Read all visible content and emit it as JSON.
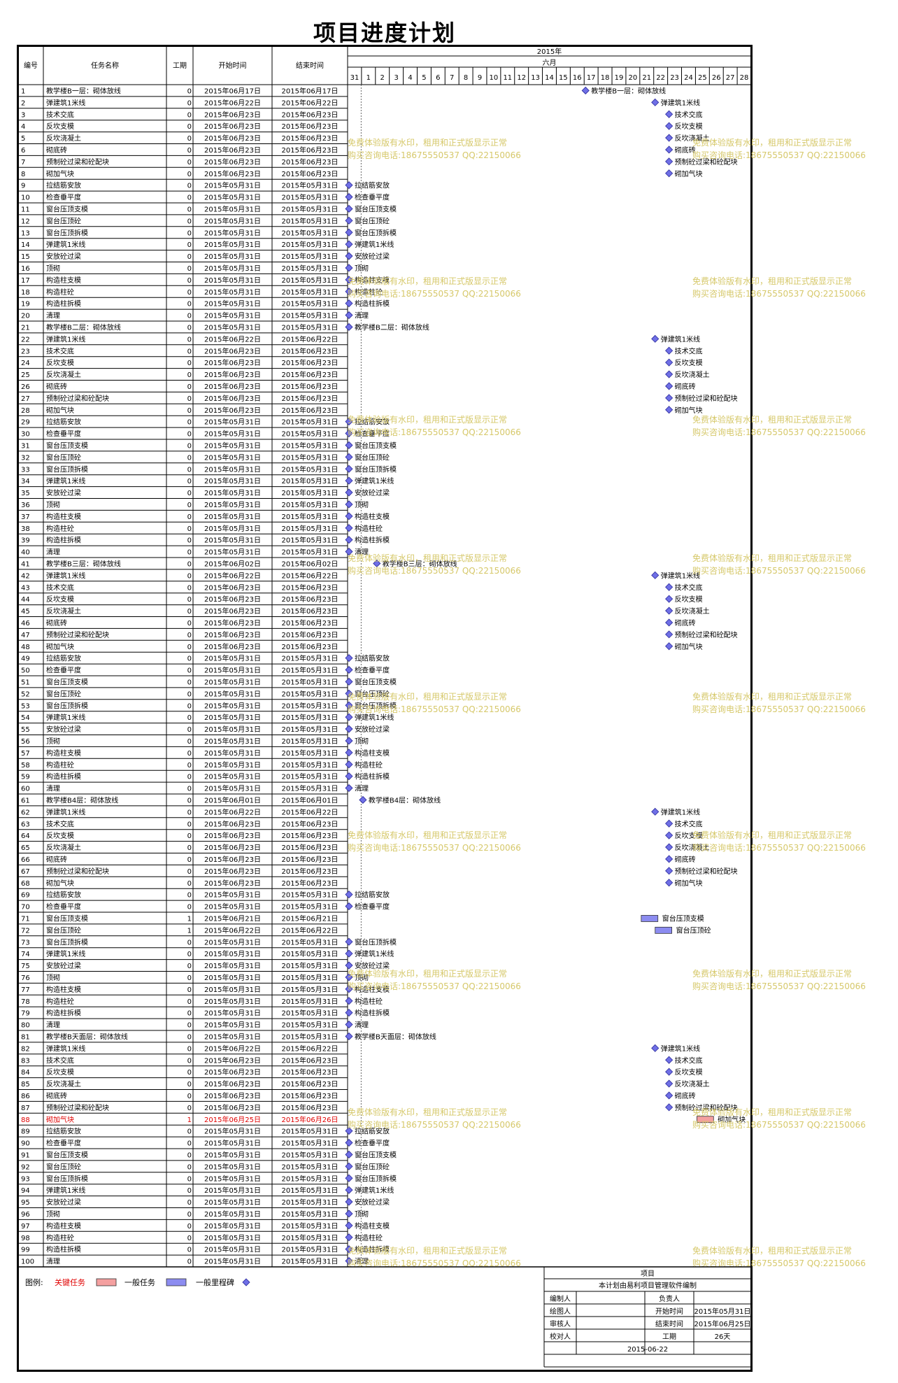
{
  "title": "项目进度计划",
  "header": {
    "col_id": "编号",
    "col_name": "任务名称",
    "col_dur": "工期",
    "col_start": "开始时间",
    "col_end": "结束时间",
    "year": "2015年",
    "month": "六月",
    "days": [
      "31",
      "1",
      "2",
      "3",
      "4",
      "5",
      "6",
      "7",
      "8",
      "9",
      "10",
      "11",
      "12",
      "13",
      "14",
      "15",
      "16",
      "17",
      "18",
      "19",
      "20",
      "21",
      "22",
      "23",
      "24",
      "25",
      "26",
      "27",
      "28"
    ]
  },
  "colors": {
    "critical": "#f4a0a0",
    "normal": "#8c8cf0",
    "milestone": "#6f6fe6",
    "critical_text": "#e00000",
    "watermark": "#d6c86a"
  },
  "watermark": {
    "line1": "免费体验版有水印，租用和正式版显示正常",
    "line2": "购买咨询电话:18675550537 QQ:22150066"
  },
  "legend": {
    "label": "图例:",
    "critical": "关键任务",
    "normal": "一般任务",
    "milestone": "一般里程碑"
  },
  "footer": {
    "project": "项目",
    "made_by": "本计划由易利项目管理软件编制",
    "editor": "编制人",
    "owner": "负责人",
    "drawer": "绘图人",
    "start_label": "开始时间",
    "start_value": "2015年05月31日",
    "reviewer": "审核人",
    "end_label": "结束时间",
    "end_value": "2015年06月25日",
    "checker": "校对人",
    "dur_label": "工期",
    "dur_value": "26天",
    "date": "2015-06-22"
  },
  "tasks": [
    {
      "id": "1",
      "name": "教学楼B一层：砌体放线",
      "dur": "0",
      "start": "2015年06月17日",
      "end": "2015年06月17日",
      "day": 17,
      "type": "milestone"
    },
    {
      "id": "2",
      "name": "弹建筑1米线",
      "dur": "0",
      "start": "2015年06月22日",
      "end": "2015年06月22日",
      "day": 22,
      "type": "milestone"
    },
    {
      "id": "3",
      "name": "技术交底",
      "dur": "0",
      "start": "2015年06月23日",
      "end": "2015年06月23日",
      "day": 23,
      "type": "milestone"
    },
    {
      "id": "4",
      "name": "反坎支模",
      "dur": "0",
      "start": "2015年06月23日",
      "end": "2015年06月23日",
      "day": 23,
      "type": "milestone"
    },
    {
      "id": "5",
      "name": "反坎浇凝土",
      "dur": "0",
      "start": "2015年06月23日",
      "end": "2015年06月23日",
      "day": 23,
      "type": "milestone"
    },
    {
      "id": "6",
      "name": "砌底砖",
      "dur": "0",
      "start": "2015年06月23日",
      "end": "2015年06月23日",
      "day": 23,
      "type": "milestone"
    },
    {
      "id": "7",
      "name": "预制砼过梁和砼配块",
      "dur": "0",
      "start": "2015年06月23日",
      "end": "2015年06月23日",
      "day": 23,
      "type": "milestone"
    },
    {
      "id": "8",
      "name": "砌加气块",
      "dur": "0",
      "start": "2015年06月23日",
      "end": "2015年06月23日",
      "day": 23,
      "type": "milestone"
    },
    {
      "id": "9",
      "name": "拉结筋安放",
      "dur": "0",
      "start": "2015年05月31日",
      "end": "2015年05月31日",
      "day": 0,
      "type": "milestone"
    },
    {
      "id": "10",
      "name": "检查垂平度",
      "dur": "0",
      "start": "2015年05月31日",
      "end": "2015年05月31日",
      "day": 0,
      "type": "milestone"
    },
    {
      "id": "11",
      "name": "窗台压顶支模",
      "dur": "0",
      "start": "2015年05月31日",
      "end": "2015年05月31日",
      "day": 0,
      "type": "milestone"
    },
    {
      "id": "12",
      "name": "窗台压顶砼",
      "dur": "0",
      "start": "2015年05月31日",
      "end": "2015年05月31日",
      "day": 0,
      "type": "milestone"
    },
    {
      "id": "13",
      "name": "窗台压顶拆模",
      "dur": "0",
      "start": "2015年05月31日",
      "end": "2015年05月31日",
      "day": 0,
      "type": "milestone"
    },
    {
      "id": "14",
      "name": "弹建筑1米线",
      "dur": "0",
      "start": "2015年05月31日",
      "end": "2015年05月31日",
      "day": 0,
      "type": "milestone"
    },
    {
      "id": "15",
      "name": "安放砼过梁",
      "dur": "0",
      "start": "2015年05月31日",
      "end": "2015年05月31日",
      "day": 0,
      "type": "milestone"
    },
    {
      "id": "16",
      "name": "顶砌",
      "dur": "0",
      "start": "2015年05月31日",
      "end": "2015年05月31日",
      "day": 0,
      "type": "milestone"
    },
    {
      "id": "17",
      "name": "构造柱支模",
      "dur": "0",
      "start": "2015年05月31日",
      "end": "2015年05月31日",
      "day": 0,
      "type": "milestone"
    },
    {
      "id": "18",
      "name": "构造柱砼",
      "dur": "0",
      "start": "2015年05月31日",
      "end": "2015年05月31日",
      "day": 0,
      "type": "milestone"
    },
    {
      "id": "19",
      "name": "构造柱拆模",
      "dur": "0",
      "start": "2015年05月31日",
      "end": "2015年05月31日",
      "day": 0,
      "type": "milestone"
    },
    {
      "id": "20",
      "name": "清理",
      "dur": "0",
      "start": "2015年05月31日",
      "end": "2015年05月31日",
      "day": 0,
      "type": "milestone"
    },
    {
      "id": "21",
      "name": "教学楼B二层：砌体放线",
      "dur": "0",
      "start": "2015年05月31日",
      "end": "2015年05月31日",
      "day": 0,
      "type": "milestone"
    },
    {
      "id": "22",
      "name": "弹建筑1米线",
      "dur": "0",
      "start": "2015年06月22日",
      "end": "2015年06月22日",
      "day": 22,
      "type": "milestone"
    },
    {
      "id": "23",
      "name": "技术交底",
      "dur": "0",
      "start": "2015年06月23日",
      "end": "2015年06月23日",
      "day": 23,
      "type": "milestone"
    },
    {
      "id": "24",
      "name": "反坎支模",
      "dur": "0",
      "start": "2015年06月23日",
      "end": "2015年06月23日",
      "day": 23,
      "type": "milestone"
    },
    {
      "id": "25",
      "name": "反坎浇凝土",
      "dur": "0",
      "start": "2015年06月23日",
      "end": "2015年06月23日",
      "day": 23,
      "type": "milestone"
    },
    {
      "id": "26",
      "name": "砌底砖",
      "dur": "0",
      "start": "2015年06月23日",
      "end": "2015年06月23日",
      "day": 23,
      "type": "milestone"
    },
    {
      "id": "27",
      "name": "预制砼过梁和砼配块",
      "dur": "0",
      "start": "2015年06月23日",
      "end": "2015年06月23日",
      "day": 23,
      "type": "milestone"
    },
    {
      "id": "28",
      "name": "砌加气块",
      "dur": "0",
      "start": "2015年06月23日",
      "end": "2015年06月23日",
      "day": 23,
      "type": "milestone"
    },
    {
      "id": "29",
      "name": "拉结筋安放",
      "dur": "0",
      "start": "2015年05月31日",
      "end": "2015年05月31日",
      "day": 0,
      "type": "milestone"
    },
    {
      "id": "30",
      "name": "检查垂平度",
      "dur": "0",
      "start": "2015年05月31日",
      "end": "2015年05月31日",
      "day": 0,
      "type": "milestone"
    },
    {
      "id": "31",
      "name": "窗台压顶支模",
      "dur": "0",
      "start": "2015年05月31日",
      "end": "2015年05月31日",
      "day": 0,
      "type": "milestone"
    },
    {
      "id": "32",
      "name": "窗台压顶砼",
      "dur": "0",
      "start": "2015年05月31日",
      "end": "2015年05月31日",
      "day": 0,
      "type": "milestone"
    },
    {
      "id": "33",
      "name": "窗台压顶拆模",
      "dur": "0",
      "start": "2015年05月31日",
      "end": "2015年05月31日",
      "day": 0,
      "type": "milestone"
    },
    {
      "id": "34",
      "name": "弹建筑1米线",
      "dur": "0",
      "start": "2015年05月31日",
      "end": "2015年05月31日",
      "day": 0,
      "type": "milestone"
    },
    {
      "id": "35",
      "name": "安放砼过梁",
      "dur": "0",
      "start": "2015年05月31日",
      "end": "2015年05月31日",
      "day": 0,
      "type": "milestone"
    },
    {
      "id": "36",
      "name": "顶砌",
      "dur": "0",
      "start": "2015年05月31日",
      "end": "2015年05月31日",
      "day": 0,
      "type": "milestone"
    },
    {
      "id": "37",
      "name": "构造柱支模",
      "dur": "0",
      "start": "2015年05月31日",
      "end": "2015年05月31日",
      "day": 0,
      "type": "milestone"
    },
    {
      "id": "38",
      "name": "构造柱砼",
      "dur": "0",
      "start": "2015年05月31日",
      "end": "2015年05月31日",
      "day": 0,
      "type": "milestone"
    },
    {
      "id": "39",
      "name": "构造柱拆模",
      "dur": "0",
      "start": "2015年05月31日",
      "end": "2015年05月31日",
      "day": 0,
      "type": "milestone"
    },
    {
      "id": "40",
      "name": "清理",
      "dur": "0",
      "start": "2015年05月31日",
      "end": "2015年05月31日",
      "day": 0,
      "type": "milestone"
    },
    {
      "id": "41",
      "name": "教学楼B三层：砌体放线",
      "dur": "0",
      "start": "2015年06月02日",
      "end": "2015年06月02日",
      "day": 2,
      "type": "milestone"
    },
    {
      "id": "42",
      "name": "弹建筑1米线",
      "dur": "0",
      "start": "2015年06月22日",
      "end": "2015年06月22日",
      "day": 22,
      "type": "milestone"
    },
    {
      "id": "43",
      "name": "技术交底",
      "dur": "0",
      "start": "2015年06月23日",
      "end": "2015年06月23日",
      "day": 23,
      "type": "milestone"
    },
    {
      "id": "44",
      "name": "反坎支模",
      "dur": "0",
      "start": "2015年06月23日",
      "end": "2015年06月23日",
      "day": 23,
      "type": "milestone"
    },
    {
      "id": "45",
      "name": "反坎浇凝土",
      "dur": "0",
      "start": "2015年06月23日",
      "end": "2015年06月23日",
      "day": 23,
      "type": "milestone"
    },
    {
      "id": "46",
      "name": "砌底砖",
      "dur": "0",
      "start": "2015年06月23日",
      "end": "2015年06月23日",
      "day": 23,
      "type": "milestone"
    },
    {
      "id": "47",
      "name": "预制砼过梁和砼配块",
      "dur": "0",
      "start": "2015年06月23日",
      "end": "2015年06月23日",
      "day": 23,
      "type": "milestone"
    },
    {
      "id": "48",
      "name": "砌加气块",
      "dur": "0",
      "start": "2015年06月23日",
      "end": "2015年06月23日",
      "day": 23,
      "type": "milestone"
    },
    {
      "id": "49",
      "name": "拉结筋安放",
      "dur": "0",
      "start": "2015年05月31日",
      "end": "2015年05月31日",
      "day": 0,
      "type": "milestone"
    },
    {
      "id": "50",
      "name": "检查垂平度",
      "dur": "0",
      "start": "2015年05月31日",
      "end": "2015年05月31日",
      "day": 0,
      "type": "milestone"
    },
    {
      "id": "51",
      "name": "窗台压顶支模",
      "dur": "0",
      "start": "2015年05月31日",
      "end": "2015年05月31日",
      "day": 0,
      "type": "milestone"
    },
    {
      "id": "52",
      "name": "窗台压顶砼",
      "dur": "0",
      "start": "2015年05月31日",
      "end": "2015年05月31日",
      "day": 0,
      "type": "milestone"
    },
    {
      "id": "53",
      "name": "窗台压顶拆模",
      "dur": "0",
      "start": "2015年05月31日",
      "end": "2015年05月31日",
      "day": 0,
      "type": "milestone"
    },
    {
      "id": "54",
      "name": "弹建筑1米线",
      "dur": "0",
      "start": "2015年05月31日",
      "end": "2015年05月31日",
      "day": 0,
      "type": "milestone"
    },
    {
      "id": "55",
      "name": "安放砼过梁",
      "dur": "0",
      "start": "2015年05月31日",
      "end": "2015年05月31日",
      "day": 0,
      "type": "milestone"
    },
    {
      "id": "56",
      "name": "顶砌",
      "dur": "0",
      "start": "2015年05月31日",
      "end": "2015年05月31日",
      "day": 0,
      "type": "milestone"
    },
    {
      "id": "57",
      "name": "构造柱支模",
      "dur": "0",
      "start": "2015年05月31日",
      "end": "2015年05月31日",
      "day": 0,
      "type": "milestone"
    },
    {
      "id": "58",
      "name": "构造柱砼",
      "dur": "0",
      "start": "2015年05月31日",
      "end": "2015年05月31日",
      "day": 0,
      "type": "milestone"
    },
    {
      "id": "59",
      "name": "构造柱拆模",
      "dur": "0",
      "start": "2015年05月31日",
      "end": "2015年05月31日",
      "day": 0,
      "type": "milestone"
    },
    {
      "id": "60",
      "name": "清理",
      "dur": "0",
      "start": "2015年05月31日",
      "end": "2015年05月31日",
      "day": 0,
      "type": "milestone"
    },
    {
      "id": "61",
      "name": "教学楼B4层：砌体放线",
      "dur": "0",
      "start": "2015年06月01日",
      "end": "2015年06月01日",
      "day": 1,
      "type": "milestone"
    },
    {
      "id": "62",
      "name": "弹建筑1米线",
      "dur": "0",
      "start": "2015年06月22日",
      "end": "2015年06月22日",
      "day": 22,
      "type": "milestone"
    },
    {
      "id": "63",
      "name": "技术交底",
      "dur": "0",
      "start": "2015年06月23日",
      "end": "2015年06月23日",
      "day": 23,
      "type": "milestone"
    },
    {
      "id": "64",
      "name": "反坎支模",
      "dur": "0",
      "start": "2015年06月23日",
      "end": "2015年06月23日",
      "day": 23,
      "type": "milestone"
    },
    {
      "id": "65",
      "name": "反坎浇凝土",
      "dur": "0",
      "start": "2015年06月23日",
      "end": "2015年06月23日",
      "day": 23,
      "type": "milestone"
    },
    {
      "id": "66",
      "name": "砌底砖",
      "dur": "0",
      "start": "2015年06月23日",
      "end": "2015年06月23日",
      "day": 23,
      "type": "milestone"
    },
    {
      "id": "67",
      "name": "预制砼过梁和砼配块",
      "dur": "0",
      "start": "2015年06月23日",
      "end": "2015年06月23日",
      "day": 23,
      "type": "milestone"
    },
    {
      "id": "68",
      "name": "砌加气块",
      "dur": "0",
      "start": "2015年06月23日",
      "end": "2015年06月23日",
      "day": 23,
      "type": "milestone"
    },
    {
      "id": "69",
      "name": "拉结筋安放",
      "dur": "0",
      "start": "2015年05月31日",
      "end": "2015年05月31日",
      "day": 0,
      "type": "milestone"
    },
    {
      "id": "70",
      "name": "检查垂平度",
      "dur": "0",
      "start": "2015年05月31日",
      "end": "2015年05月31日",
      "day": 0,
      "type": "milestone"
    },
    {
      "id": "71",
      "name": "窗台压顶支模",
      "dur": "1",
      "start": "2015年06月21日",
      "end": "2015年06月21日",
      "day": 21,
      "type": "normal"
    },
    {
      "id": "72",
      "name": "窗台压顶砼",
      "dur": "1",
      "start": "2015年06月22日",
      "end": "2015年06月22日",
      "day": 22,
      "type": "normal"
    },
    {
      "id": "73",
      "name": "窗台压顶拆模",
      "dur": "0",
      "start": "2015年05月31日",
      "end": "2015年05月31日",
      "day": 0,
      "type": "milestone"
    },
    {
      "id": "74",
      "name": "弹建筑1米线",
      "dur": "0",
      "start": "2015年05月31日",
      "end": "2015年05月31日",
      "day": 0,
      "type": "milestone"
    },
    {
      "id": "75",
      "name": "安放砼过梁",
      "dur": "0",
      "start": "2015年05月31日",
      "end": "2015年05月31日",
      "day": 0,
      "type": "milestone"
    },
    {
      "id": "76",
      "name": "顶砌",
      "dur": "0",
      "start": "2015年05月31日",
      "end": "2015年05月31日",
      "day": 0,
      "type": "milestone"
    },
    {
      "id": "77",
      "name": "构造柱支模",
      "dur": "0",
      "start": "2015年05月31日",
      "end": "2015年05月31日",
      "day": 0,
      "type": "milestone"
    },
    {
      "id": "78",
      "name": "构造柱砼",
      "dur": "0",
      "start": "2015年05月31日",
      "end": "2015年05月31日",
      "day": 0,
      "type": "milestone"
    },
    {
      "id": "79",
      "name": "构造柱拆模",
      "dur": "0",
      "start": "2015年05月31日",
      "end": "2015年05月31日",
      "day": 0,
      "type": "milestone"
    },
    {
      "id": "80",
      "name": "清理",
      "dur": "0",
      "start": "2015年05月31日",
      "end": "2015年05月31日",
      "day": 0,
      "type": "milestone"
    },
    {
      "id": "81",
      "name": "教学楼B天面层：砌体放线",
      "dur": "0",
      "start": "2015年05月31日",
      "end": "2015年05月31日",
      "day": 0,
      "type": "milestone"
    },
    {
      "id": "82",
      "name": "弹建筑1米线",
      "dur": "0",
      "start": "2015年06月22日",
      "end": "2015年06月22日",
      "day": 22,
      "type": "milestone"
    },
    {
      "id": "83",
      "name": "技术交底",
      "dur": "0",
      "start": "2015年06月23日",
      "end": "2015年06月23日",
      "day": 23,
      "type": "milestone"
    },
    {
      "id": "84",
      "name": "反坎支模",
      "dur": "0",
      "start": "2015年06月23日",
      "end": "2015年06月23日",
      "day": 23,
      "type": "milestone"
    },
    {
      "id": "85",
      "name": "反坎浇凝土",
      "dur": "0",
      "start": "2015年06月23日",
      "end": "2015年06月23日",
      "day": 23,
      "type": "milestone"
    },
    {
      "id": "86",
      "name": "砌底砖",
      "dur": "0",
      "start": "2015年06月23日",
      "end": "2015年06月23日",
      "day": 23,
      "type": "milestone"
    },
    {
      "id": "87",
      "name": "预制砼过梁和砼配块",
      "dur": "0",
      "start": "2015年06月23日",
      "end": "2015年06月23日",
      "day": 23,
      "type": "milestone"
    },
    {
      "id": "88",
      "name": "砌加气块",
      "dur": "1",
      "start": "2015年06月25日",
      "end": "2015年06月26日",
      "day": 25,
      "type": "critical"
    },
    {
      "id": "89",
      "name": "拉结筋安放",
      "dur": "0",
      "start": "2015年05月31日",
      "end": "2015年05月31日",
      "day": 0,
      "type": "milestone"
    },
    {
      "id": "90",
      "name": "检查垂平度",
      "dur": "0",
      "start": "2015年05月31日",
      "end": "2015年05月31日",
      "day": 0,
      "type": "milestone"
    },
    {
      "id": "91",
      "name": "窗台压顶支模",
      "dur": "0",
      "start": "2015年05月31日",
      "end": "2015年05月31日",
      "day": 0,
      "type": "milestone"
    },
    {
      "id": "92",
      "name": "窗台压顶砼",
      "dur": "0",
      "start": "2015年05月31日",
      "end": "2015年05月31日",
      "day": 0,
      "type": "milestone"
    },
    {
      "id": "93",
      "name": "窗台压顶拆模",
      "dur": "0",
      "start": "2015年05月31日",
      "end": "2015年05月31日",
      "day": 0,
      "type": "milestone"
    },
    {
      "id": "94",
      "name": "弹建筑1米线",
      "dur": "0",
      "start": "2015年05月31日",
      "end": "2015年05月31日",
      "day": 0,
      "type": "milestone"
    },
    {
      "id": "95",
      "name": "安放砼过梁",
      "dur": "0",
      "start": "2015年05月31日",
      "end": "2015年05月31日",
      "day": 0,
      "type": "milestone"
    },
    {
      "id": "96",
      "name": "顶砌",
      "dur": "0",
      "start": "2015年05月31日",
      "end": "2015年05月31日",
      "day": 0,
      "type": "milestone"
    },
    {
      "id": "97",
      "name": "构造柱支模",
      "dur": "0",
      "start": "2015年05月31日",
      "end": "2015年05月31日",
      "day": 0,
      "type": "milestone"
    },
    {
      "id": "98",
      "name": "构造柱砼",
      "dur": "0",
      "start": "2015年05月31日",
      "end": "2015年05月31日",
      "day": 0,
      "type": "milestone"
    },
    {
      "id": "99",
      "name": "构造柱拆模",
      "dur": "0",
      "start": "2015年05月31日",
      "end": "2015年05月31日",
      "day": 0,
      "type": "milestone"
    },
    {
      "id": "100",
      "name": "清理",
      "dur": "0",
      "start": "2015年05月31日",
      "end": "2015年05月31日",
      "day": 0,
      "type": "milestone"
    }
  ]
}
